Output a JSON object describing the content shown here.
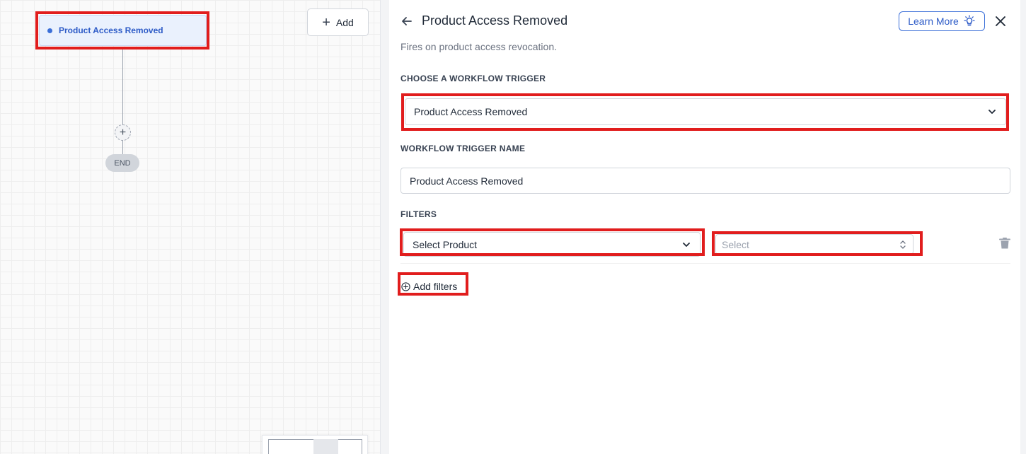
{
  "canvas": {
    "trigger_node_label": "Product Access Removed",
    "end_label": "END",
    "add_button_label": "Add"
  },
  "panel": {
    "title": "Product Access Removed",
    "learn_more_label": "Learn More",
    "description": "Fires on product access revocation.",
    "trigger_section_label": "CHOOSE A WORKFLOW TRIGGER",
    "trigger_select_value": "Product Access Removed",
    "name_section_label": "WORKFLOW TRIGGER NAME",
    "name_input_value": "Product Access Removed",
    "filters_section_label": "FILTERS",
    "filter_product_select_value": "Select Product",
    "filter_value_placeholder": "Select",
    "add_filters_label": "Add filters"
  },
  "colors": {
    "accent": "#2d5bc7",
    "highlight": "#e11d1d",
    "node_bg": "#eaf1fd"
  },
  "icons": [
    "back-arrow-icon",
    "lightbulb-icon",
    "close-icon",
    "chevron-down-icon",
    "sort-updown-icon",
    "trash-icon",
    "plus-circle-icon",
    "plus-icon"
  ]
}
